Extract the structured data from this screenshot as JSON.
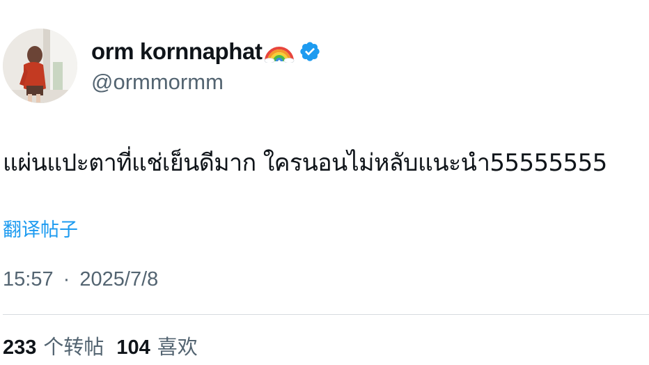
{
  "author": {
    "display_name": "orm kornnaphat",
    "handle": "@ormmormm",
    "avatar_icon": "profile-photo",
    "badge_emoji_icon": "rainbow-icon",
    "verified_icon": "verified-badge-icon",
    "verified_color": "#1d9bf0"
  },
  "post": {
    "text": "แผ่นแปะตาที่แช่เย็นดีมาก ใครนอนไม่หลับแนะนำ55555555",
    "translate_label": "翻译帖子",
    "time": "15:57",
    "separator": "·",
    "date": "2025/7/8"
  },
  "stats": {
    "reposts_count": "233",
    "reposts_label": "个转帖",
    "likes_count": "104",
    "likes_label": "喜欢"
  },
  "colors": {
    "text_primary": "#0f1419",
    "text_secondary": "#536471",
    "link": "#1d9bf0",
    "divider": "#d7dbdf"
  }
}
